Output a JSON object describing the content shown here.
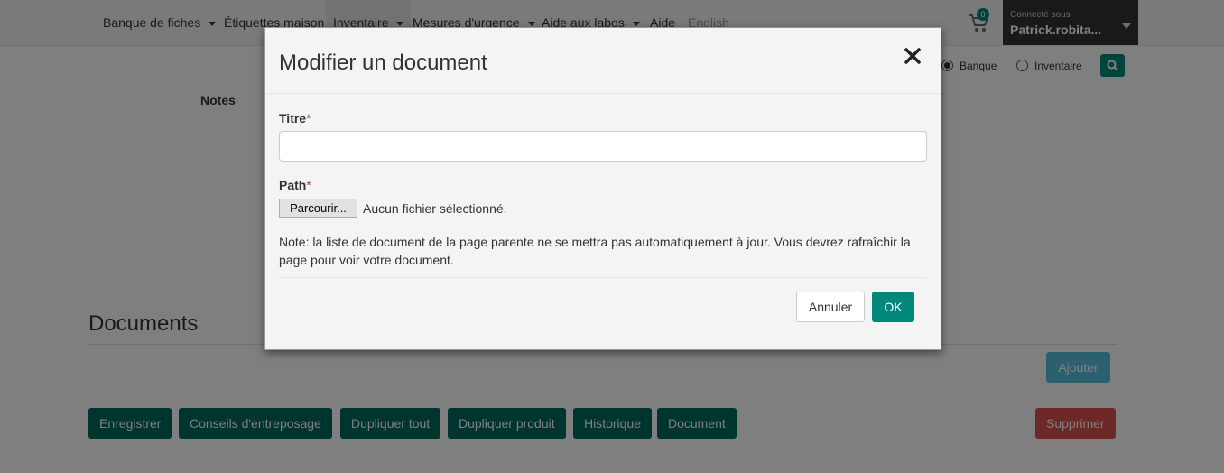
{
  "nav": {
    "items": [
      {
        "label": "Banque de fiches",
        "dropdown": true
      },
      {
        "label": "Étiquettes maison",
        "dropdown": false
      },
      {
        "label": "Inventaire",
        "dropdown": true,
        "active": true
      },
      {
        "label": "Mesures d'urgence",
        "dropdown": true
      },
      {
        "label": "Aide aux labos",
        "dropdown": true
      },
      {
        "label": "Aide",
        "dropdown": false
      },
      {
        "label": "English",
        "dropdown": false
      }
    ],
    "cart_count": "0",
    "user": {
      "caption": "Connecté sous",
      "name": "Patrick.robita..."
    }
  },
  "search": {
    "scopes": [
      {
        "label": "Banque",
        "checked": true
      },
      {
        "label": "Inventaire",
        "checked": false
      }
    ],
    "button_icon": "search-icon"
  },
  "page": {
    "notes_label": "Notes",
    "documents_title": "Documents",
    "add_label": "Ajouter",
    "actions": [
      "Enregistrer",
      "Conseils d'entreposage",
      "Dupliquer tout",
      "Dupliquer produit",
      "Historique",
      "Document"
    ],
    "delete_label": "Supprimer"
  },
  "modal": {
    "title": "Modifier un document",
    "close_icon": "close-icon",
    "title_field": {
      "label": "Titre",
      "required_mark": "*",
      "value": ""
    },
    "path_field": {
      "label": "Path",
      "required_mark": "*",
      "browse_label": "Parcourir...",
      "file_status": "Aucun fichier sélectionné."
    },
    "note": "Note: la liste de document de la page parente ne se mettra pas automatiquement à jour. Vous devrez rafraîchir la page pour voir votre document.",
    "cancel_label": "Annuler",
    "ok_label": "OK"
  },
  "colors": {
    "accent": "#00897b",
    "dark_accent": "#00695c",
    "danger": "#d9534f",
    "info": "#5bc0de"
  }
}
